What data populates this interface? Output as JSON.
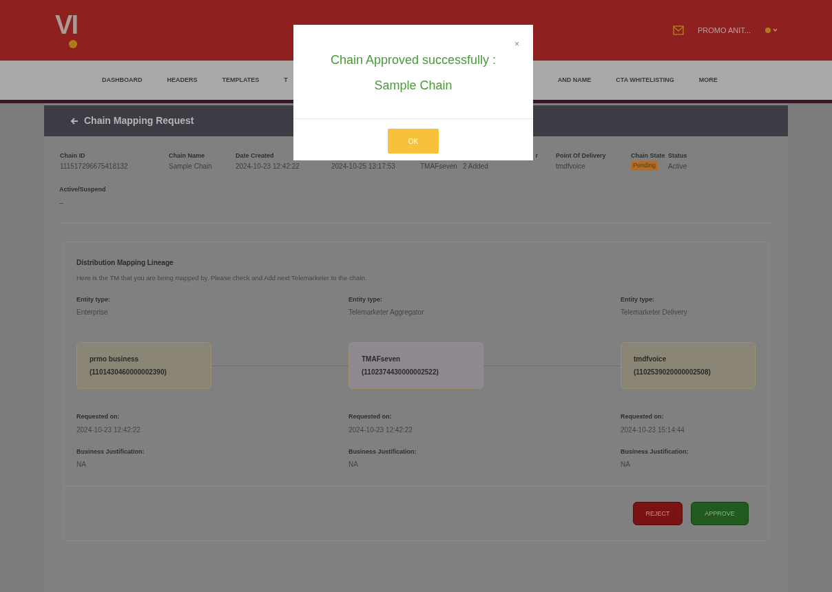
{
  "header": {
    "logo": "VI",
    "user": "PROMO ANIT..."
  },
  "nav": [
    {
      "label": "DASHBOARD",
      "kind": "item"
    },
    {
      "label": "HEADERS",
      "kind": "item"
    },
    {
      "label": "TEMPLATES",
      "kind": "item"
    },
    {
      "label": "T",
      "kind": "item"
    },
    {
      "kind": "gap"
    },
    {
      "label": "AND NAME",
      "kind": "item"
    },
    {
      "label": "CTA WHITELISTING",
      "kind": "item"
    },
    {
      "label": "MORE",
      "kind": "item"
    }
  ],
  "page": {
    "title": "Chain Mapping Request"
  },
  "details": [
    {
      "label": "Chain ID",
      "value": "111517296675418132"
    },
    {
      "label": "Chain Name",
      "value": "Sample Chain"
    },
    {
      "label": "Date Created",
      "value": "2024-10-23 12:42:22"
    },
    {
      "value": "2024-10-25 13:17:53"
    },
    {
      "value": "TMAFseven"
    },
    {
      "label": "r",
      "value": "2 Added",
      "kind": "clipped"
    },
    {
      "label": "Point Of Delivery",
      "value": "tmdfvoice"
    },
    {
      "label": "Chain State",
      "value": "Pending",
      "kind": "badge"
    },
    {
      "label": "Status",
      "value": "Active"
    }
  ],
  "active_suspend": {
    "label": "Active/Suspend",
    "value": "--"
  },
  "lineage": {
    "title": "Distribution Mapping Lineage",
    "description": "Here is the TM that you are being mapped by. Please check and Add next Telemarketer to the chain.",
    "entities": [
      {
        "type_label": "Entity type:",
        "type": "Enterprise",
        "name": "prmo business",
        "id": "(1101430460000002390)",
        "color": "#8a8574",
        "requested_label": "Requested on:",
        "requested": "2024-10-23 12:42:22",
        "justification_label": "Business Justification:",
        "justification": "NA"
      },
      {
        "type_label": "Entity type:",
        "type": "Telemarketer Aggregator",
        "name": "TMAFseven",
        "id": "(1102374430000002522)",
        "color": "#8e8890",
        "requested_label": "Requested on:",
        "requested": "2024-10-23 12:42:22",
        "justification_label": "Business Justification:",
        "justification": "NA"
      },
      {
        "type_label": "Entity type:",
        "type": "Telemarketer Delivery",
        "name": "tmdfvoice",
        "id": "(1102539020000002508)",
        "color": "#8a8574",
        "requested_label": "Requested on:",
        "requested": "2024-10-23 15:14:44",
        "justification_label": "Business Justification:",
        "justification": "NA"
      }
    ]
  },
  "actions": {
    "reject": "REJECT",
    "approve": "APPROVE"
  },
  "modal": {
    "title": "Chain Approved successfully :",
    "subtitle": "Sample Chain",
    "close": "×",
    "ok": "OK"
  }
}
